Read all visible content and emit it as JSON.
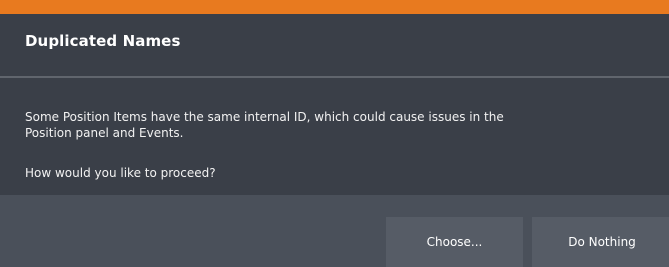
{
  "dialog": {
    "title": "Duplicated Names",
    "message": "Some Position Items have the same internal ID, which could cause issues in the Position panel and Events.",
    "question": "How would you like to proceed?",
    "buttons": {
      "choose": "Choose...",
      "do_nothing": "Do Nothing"
    }
  },
  "colors": {
    "accent": "#e87a1f",
    "background": "#3a3f48",
    "footer": "#4a505a",
    "button": "#565c66"
  }
}
